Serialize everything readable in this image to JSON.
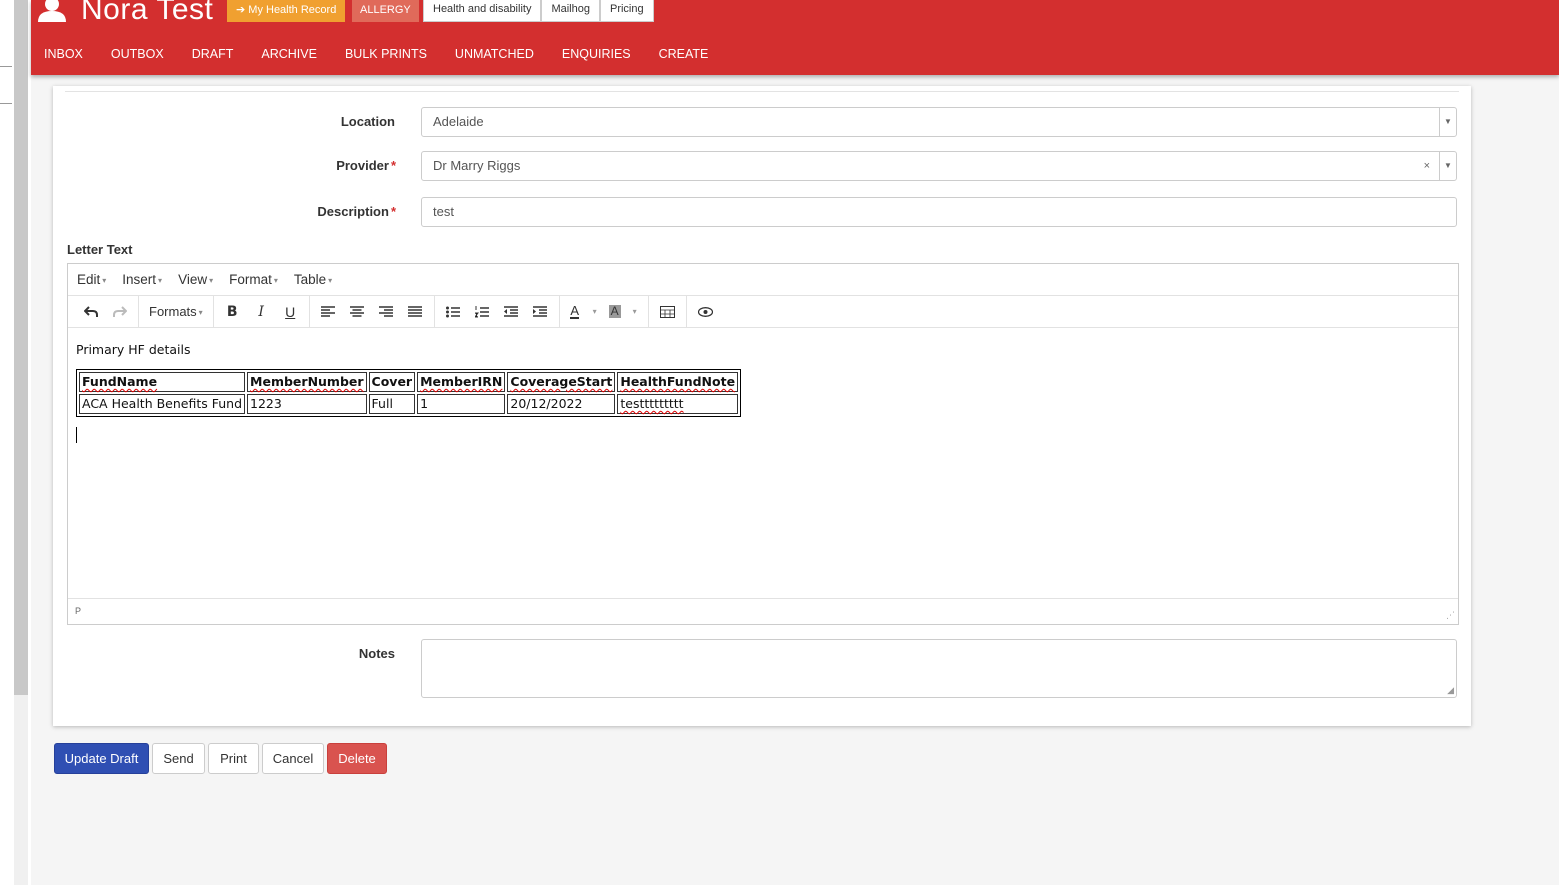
{
  "header": {
    "patient_name": "Nora Test",
    "badge_mhr": "My Health Record",
    "badge_allergy": "ALLERGY",
    "top_tabs": [
      "Health and disability",
      "Mailhog",
      "Pricing"
    ],
    "nav": [
      "INBOX",
      "OUTBOX",
      "DRAFT",
      "ARCHIVE",
      "BULK PRINTS",
      "UNMATCHED",
      "ENQUIRIES",
      "CREATE"
    ]
  },
  "form": {
    "location_label": "Location",
    "location_value": "Adelaide",
    "provider_label": "Provider",
    "provider_value": "Dr Marry Riggs",
    "description_label": "Description",
    "description_value": "test",
    "required_mark": "*",
    "clear_glyph": "×",
    "arrow_glyph": "▼",
    "letter_text_label": "Letter Text",
    "notes_label": "Notes"
  },
  "editor": {
    "menus": [
      "Edit",
      "Insert",
      "View",
      "Format",
      "Table"
    ],
    "formats_label": "Formats",
    "caret_glyph": "▾",
    "paragraph": "Primary HF details",
    "table": {
      "headers": [
        "FundName",
        "MemberNumber",
        "Cover",
        "MemberIRN",
        "CoverageStart",
        "HealthFundNote"
      ],
      "row": [
        "ACA Health Benefits Fund",
        "1223",
        "Full",
        "1",
        "20/12/2022",
        "testtttttttt"
      ]
    },
    "status_path": "P"
  },
  "buttons": {
    "update_draft": "Update Draft",
    "send": "Send",
    "print": "Print",
    "cancel": "Cancel",
    "delete": "Delete"
  },
  "colors": {
    "header_bg": "#d32f2f",
    "badge_mhr": "#f0a030",
    "badge_allergy": "#e06a5a",
    "primary": "#2f4fb3",
    "danger": "#d9534f"
  }
}
